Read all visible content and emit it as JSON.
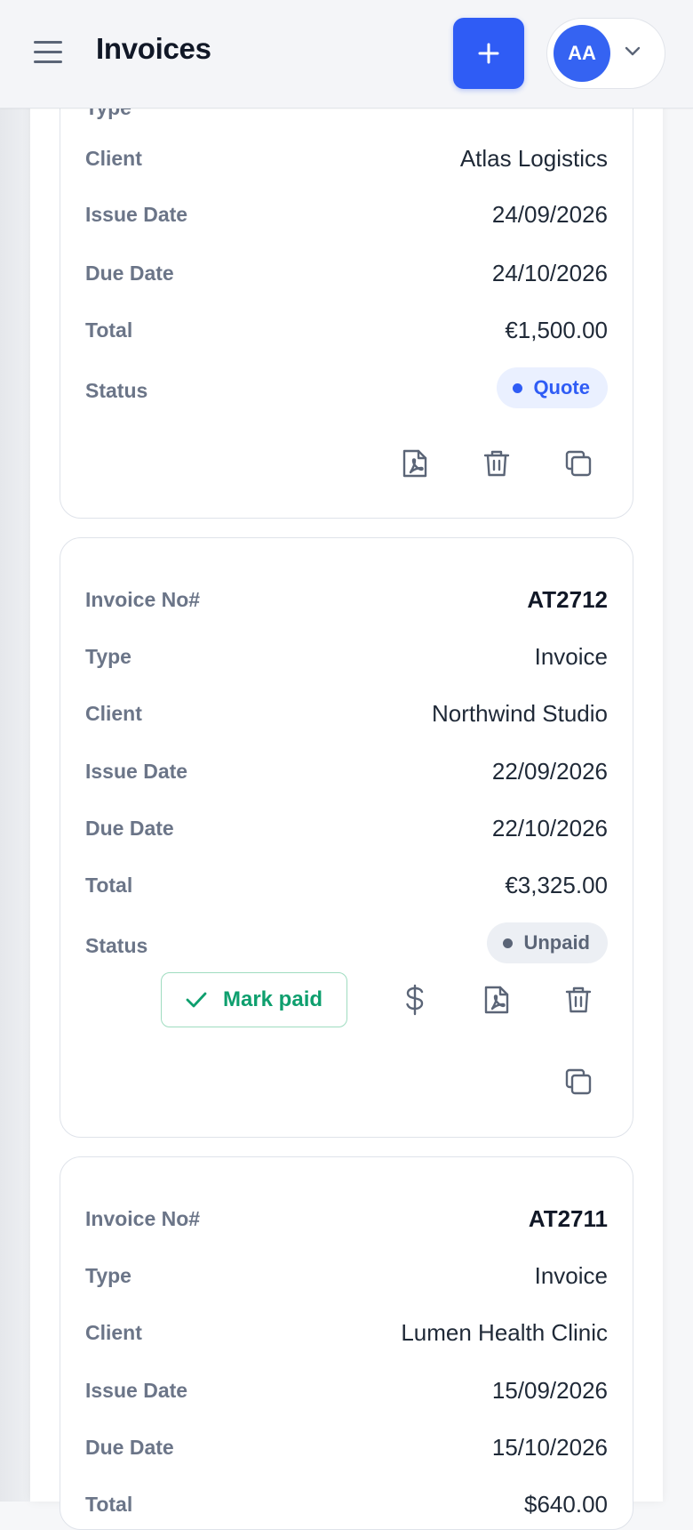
{
  "header": {
    "title": "Invoices",
    "user_initials": "AA"
  },
  "labels": {
    "invoice_no": "Invoice No#",
    "type": "Type",
    "client": "Client",
    "issue_date": "Issue Date",
    "due_date": "Due Date",
    "total": "Total",
    "status": "Status",
    "mark_paid": "Mark paid"
  },
  "cards": [
    {
      "client": "Atlas Logistics",
      "issue_date": "24/09/2026",
      "due_date": "24/10/2026",
      "total": "€1,500.00",
      "status": "Quote"
    },
    {
      "invoice_no": "AT2712",
      "type": "Invoice",
      "client": "Northwind Studio",
      "issue_date": "22/09/2026",
      "due_date": "22/10/2026",
      "total": "€3,325.00",
      "status": "Unpaid"
    },
    {
      "invoice_no": "AT2711",
      "type": "Invoice",
      "client": "Lumen Health Clinic",
      "issue_date": "15/09/2026",
      "due_date": "15/10/2026",
      "total": "$640.00"
    }
  ],
  "colors": {
    "accent": "#2f5cf5",
    "quote_badge": "#eaf0ff",
    "unpaid_badge": "#eceff4",
    "success": "#0e9f6e"
  },
  "icons": [
    "menu-icon",
    "plus-icon",
    "chevron-down-icon",
    "pdf-icon",
    "trash-icon",
    "duplicate-icon",
    "dollar-icon",
    "check-icon"
  ]
}
